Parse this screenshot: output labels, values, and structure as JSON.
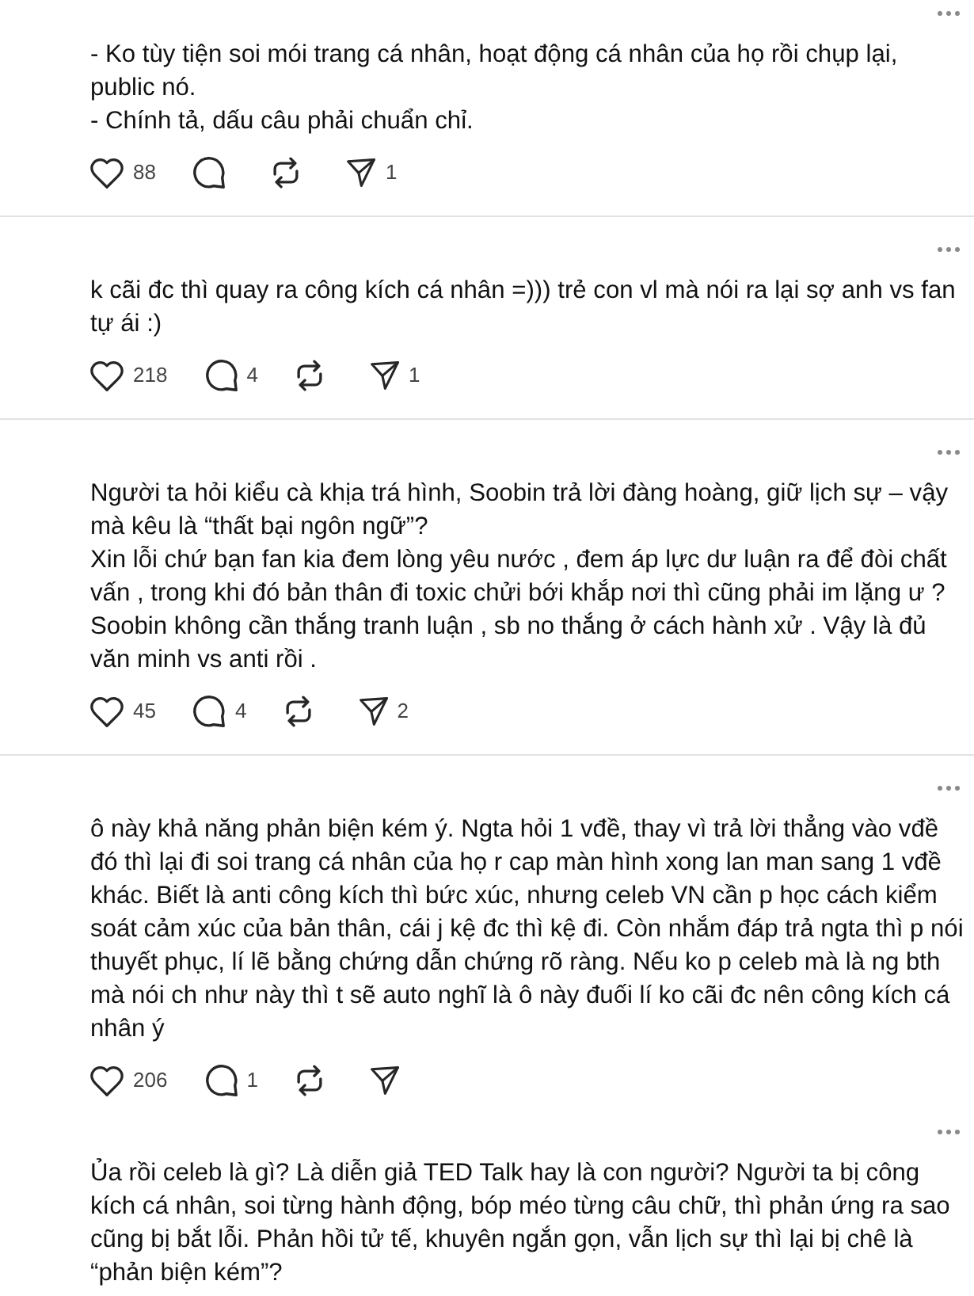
{
  "posts": [
    {
      "paragraphs": [
        "- Ko tùy tiện soi mói trang cá nhân, hoạt động cá nhân của họ rồi chụp lại, public nó.",
        "- Chính tả, dấu câu phải chuẩn chỉ."
      ],
      "actions": [
        {
          "kind": "like",
          "count": "88"
        },
        {
          "kind": "reply"
        },
        {
          "kind": "repost"
        },
        {
          "kind": "share",
          "count": "1"
        }
      ],
      "separator": true
    },
    {
      "paragraphs": [
        "k cãi đc thì quay ra công kích cá nhân =))) trẻ con vl mà nói ra lại sợ anh vs fan tự ái :)"
      ],
      "actions": [
        {
          "kind": "like",
          "count": "218"
        },
        {
          "kind": "reply",
          "count": "4"
        },
        {
          "kind": "repost"
        },
        {
          "kind": "share",
          "count": "1"
        }
      ],
      "separator": true
    },
    {
      "paragraphs": [
        "Người ta hỏi kiểu cà khịa trá hình, Soobin trả lời đàng hoàng, giữ lịch sự – vậy mà kêu là “thất bại ngôn ngữ”?",
        "Xin lỗi chứ bạn fan kia đem lòng yêu nước , đem áp lực dư luận ra để đòi chất vấn , trong khi đó bản thân đi toxic chửi bới khắp nơi thì cũng phải im lặng ư ?",
        "Soobin không cần thắng tranh luận , sb no thắng ở cách hành xử . Vậy là đủ văn minh vs anti rồi ."
      ],
      "actions": [
        {
          "kind": "like",
          "count": "45"
        },
        {
          "kind": "reply",
          "count": "4"
        },
        {
          "kind": "repost"
        },
        {
          "kind": "share",
          "count": "2"
        }
      ],
      "separator": true
    },
    {
      "paragraphs": [
        "ô này khả năng phản biện kém ý. Ngta hỏi 1 vđề, thay vì trả lời thẳng vào vđề đó thì lại đi soi trang cá nhân của họ r cap màn hình xong lan man sang 1 vđề khác. Biết là anti công kích thì bức xúc, nhưng celeb VN cần p học cách kiểm soát cảm xúc của bản thân, cái j kệ đc thì kệ đi. Còn nhắm đáp trả ngta thì p nói thuyết phục, lí lẽ bằng chứng dẫn chứng rõ ràng. Nếu ko p celeb mà là ng bth mà nói ch như này thì t sẽ auto nghĩ là ô này đuối lí ko cãi đc nên công kích cá nhân ý"
      ],
      "actions": [
        {
          "kind": "like",
          "count": "206"
        },
        {
          "kind": "reply",
          "count": "1"
        },
        {
          "kind": "repost"
        },
        {
          "kind": "share"
        }
      ],
      "separator": false
    },
    {
      "paragraphs": [
        "Ủa rồi celeb là gì? Là diễn giả TED Talk hay là con người? Người ta bị công kích cá nhân, soi từng hành động, bóp méo từng câu chữ, thì phản ứng ra sao cũng bị bắt lỗi. Phản hồi tử tế, khuyên ngắn gọn, vẫn lịch sự thì lại bị chê là “phản biện kém”?"
      ],
      "separator": false
    }
  ]
}
